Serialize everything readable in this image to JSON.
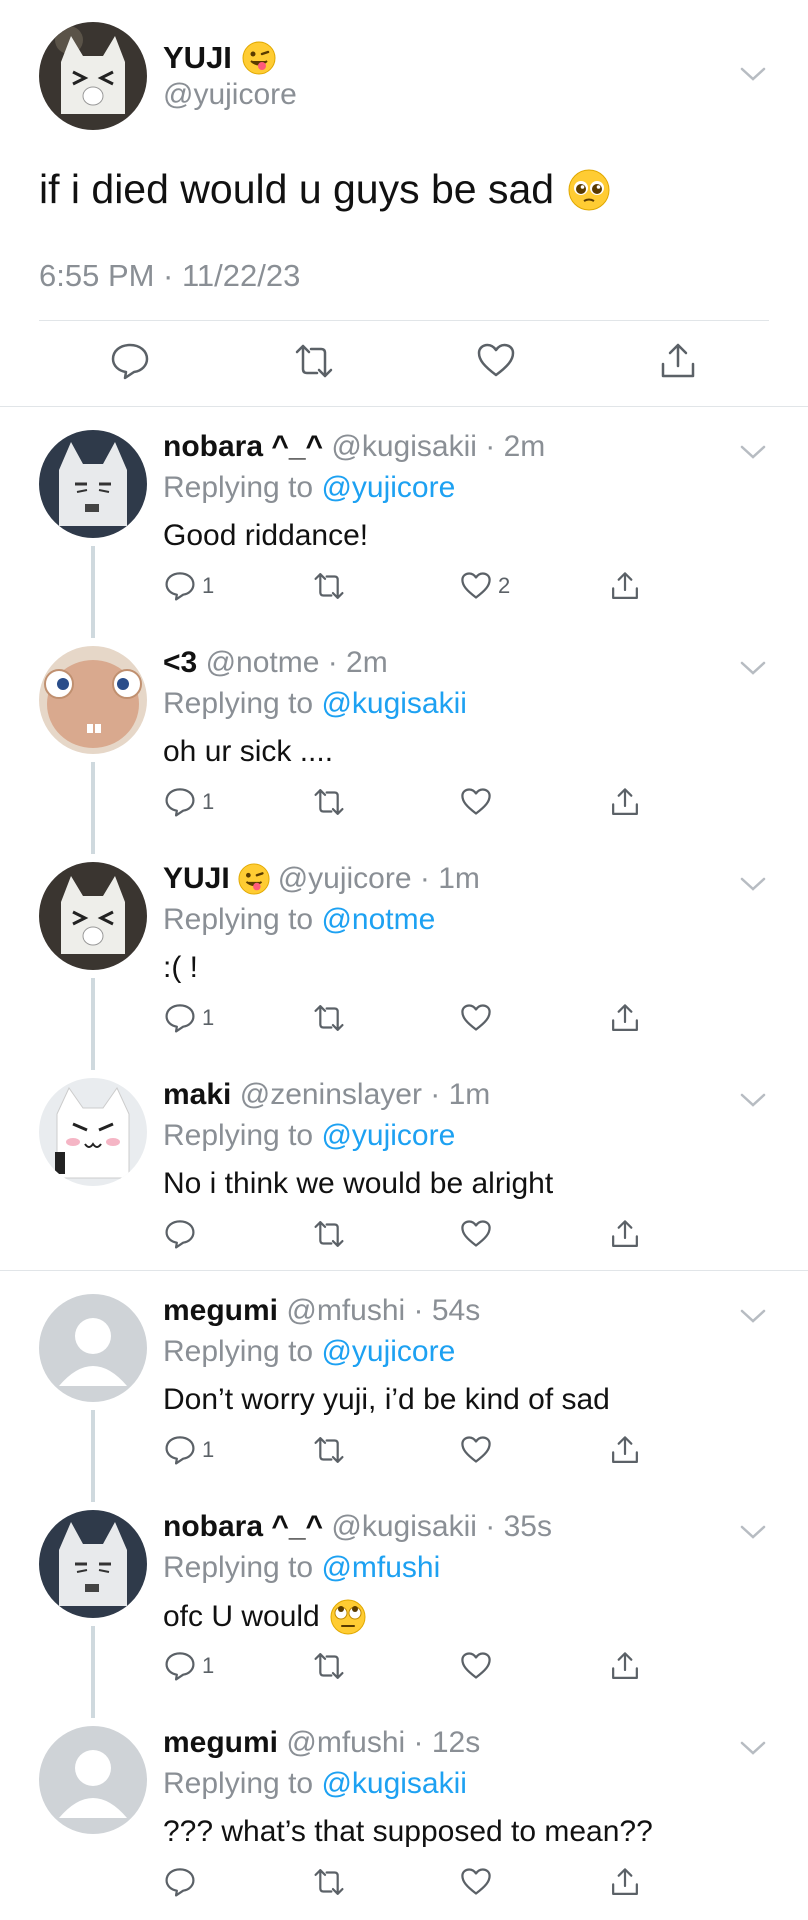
{
  "main_tweet": {
    "name": "YUJI",
    "handle": "@yujicore",
    "text": "if i died would u guys be sad",
    "timestamp": "6:55 PM · 11/22/23",
    "name_emoji_icon": "winking-tongue-emoji-icon",
    "text_emoji_icon": "pleading-face-emoji-icon"
  },
  "replies": [
    {
      "name": "nobara ^_^",
      "meta": "@kugisakii · 2m",
      "replying_label": "Replying to",
      "mention": "@yujicore",
      "text": "Good riddance!",
      "reply_count": "1",
      "like_count": "2",
      "avatar_icon": "cat-avatar-icon"
    },
    {
      "name": "<3",
      "meta": "@notme · 2m",
      "replying_label": "Replying to",
      "mention": "@kugisakii",
      "text": "oh ur sick ....",
      "reply_count": "1",
      "like_count": "",
      "avatar_icon": "creature-avatar-icon"
    },
    {
      "name": "YUJI",
      "meta": "@yujicore · 1m",
      "replying_label": "Replying to",
      "mention": "@notme",
      "text": ":( !",
      "reply_count": "1",
      "like_count": "",
      "avatar_icon": "cat-avatar-icon"
    },
    {
      "name": "maki",
      "meta": "@zeninslayer · 1m",
      "replying_label": "Replying to",
      "mention": "@yujicore",
      "text": "No i think we would be alright",
      "reply_count": "",
      "like_count": "",
      "avatar_icon": "cat-avatar-icon"
    },
    {
      "name": "megumi",
      "meta": "@mfushi · 54s",
      "replying_label": "Replying to",
      "mention": "@yujicore",
      "text": "Don’t worry yuji, i’d be kind of sad",
      "reply_count": "1",
      "like_count": "",
      "avatar_icon": "default-avatar-icon"
    },
    {
      "name": "nobara ^_^",
      "meta": "@kugisakii · 35s",
      "replying_label": "Replying to",
      "mention": "@mfushi",
      "text": "ofc U would",
      "reply_count": "1",
      "like_count": "",
      "avatar_icon": "cat-avatar-icon"
    },
    {
      "name": "megumi",
      "meta": "@mfushi · 12s",
      "replying_label": "Replying to",
      "mention": "@kugisakii",
      "text": "??? what’s that supposed to mean??",
      "reply_count": "",
      "like_count": "",
      "avatar_icon": "default-avatar-icon"
    }
  ],
  "colors": {
    "link": "#1da1f2",
    "secondary_text": "#8a8f95",
    "divider": "#e1e5e8",
    "thread_line": "#cfd9de",
    "icon": "#5b6167"
  }
}
